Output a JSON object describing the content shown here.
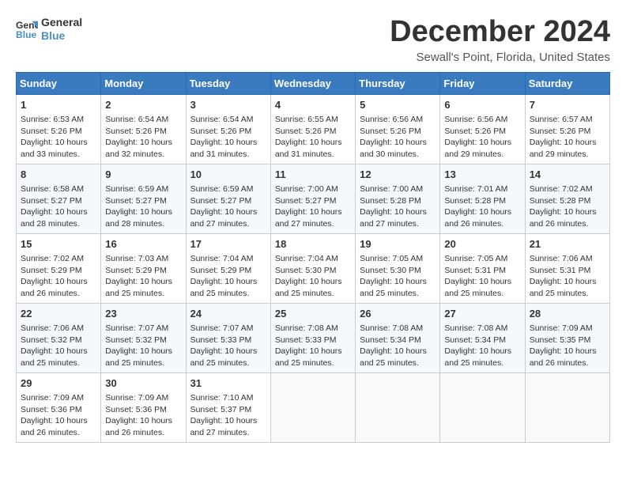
{
  "header": {
    "logo_line1": "General",
    "logo_line2": "Blue",
    "title": "December 2024",
    "subtitle": "Sewall's Point, Florida, United States"
  },
  "days_of_week": [
    "Sunday",
    "Monday",
    "Tuesday",
    "Wednesday",
    "Thursday",
    "Friday",
    "Saturday"
  ],
  "weeks": [
    [
      {
        "day": 1,
        "lines": [
          "Sunrise: 6:53 AM",
          "Sunset: 5:26 PM",
          "Daylight: 10 hours",
          "and 33 minutes."
        ]
      },
      {
        "day": 2,
        "lines": [
          "Sunrise: 6:54 AM",
          "Sunset: 5:26 PM",
          "Daylight: 10 hours",
          "and 32 minutes."
        ]
      },
      {
        "day": 3,
        "lines": [
          "Sunrise: 6:54 AM",
          "Sunset: 5:26 PM",
          "Daylight: 10 hours",
          "and 31 minutes."
        ]
      },
      {
        "day": 4,
        "lines": [
          "Sunrise: 6:55 AM",
          "Sunset: 5:26 PM",
          "Daylight: 10 hours",
          "and 31 minutes."
        ]
      },
      {
        "day": 5,
        "lines": [
          "Sunrise: 6:56 AM",
          "Sunset: 5:26 PM",
          "Daylight: 10 hours",
          "and 30 minutes."
        ]
      },
      {
        "day": 6,
        "lines": [
          "Sunrise: 6:56 AM",
          "Sunset: 5:26 PM",
          "Daylight: 10 hours",
          "and 29 minutes."
        ]
      },
      {
        "day": 7,
        "lines": [
          "Sunrise: 6:57 AM",
          "Sunset: 5:26 PM",
          "Daylight: 10 hours",
          "and 29 minutes."
        ]
      }
    ],
    [
      {
        "day": 8,
        "lines": [
          "Sunrise: 6:58 AM",
          "Sunset: 5:27 PM",
          "Daylight: 10 hours",
          "and 28 minutes."
        ]
      },
      {
        "day": 9,
        "lines": [
          "Sunrise: 6:59 AM",
          "Sunset: 5:27 PM",
          "Daylight: 10 hours",
          "and 28 minutes."
        ]
      },
      {
        "day": 10,
        "lines": [
          "Sunrise: 6:59 AM",
          "Sunset: 5:27 PM",
          "Daylight: 10 hours",
          "and 27 minutes."
        ]
      },
      {
        "day": 11,
        "lines": [
          "Sunrise: 7:00 AM",
          "Sunset: 5:27 PM",
          "Daylight: 10 hours",
          "and 27 minutes."
        ]
      },
      {
        "day": 12,
        "lines": [
          "Sunrise: 7:00 AM",
          "Sunset: 5:28 PM",
          "Daylight: 10 hours",
          "and 27 minutes."
        ]
      },
      {
        "day": 13,
        "lines": [
          "Sunrise: 7:01 AM",
          "Sunset: 5:28 PM",
          "Daylight: 10 hours",
          "and 26 minutes."
        ]
      },
      {
        "day": 14,
        "lines": [
          "Sunrise: 7:02 AM",
          "Sunset: 5:28 PM",
          "Daylight: 10 hours",
          "and 26 minutes."
        ]
      }
    ],
    [
      {
        "day": 15,
        "lines": [
          "Sunrise: 7:02 AM",
          "Sunset: 5:29 PM",
          "Daylight: 10 hours",
          "and 26 minutes."
        ]
      },
      {
        "day": 16,
        "lines": [
          "Sunrise: 7:03 AM",
          "Sunset: 5:29 PM",
          "Daylight: 10 hours",
          "and 25 minutes."
        ]
      },
      {
        "day": 17,
        "lines": [
          "Sunrise: 7:04 AM",
          "Sunset: 5:29 PM",
          "Daylight: 10 hours",
          "and 25 minutes."
        ]
      },
      {
        "day": 18,
        "lines": [
          "Sunrise: 7:04 AM",
          "Sunset: 5:30 PM",
          "Daylight: 10 hours",
          "and 25 minutes."
        ]
      },
      {
        "day": 19,
        "lines": [
          "Sunrise: 7:05 AM",
          "Sunset: 5:30 PM",
          "Daylight: 10 hours",
          "and 25 minutes."
        ]
      },
      {
        "day": 20,
        "lines": [
          "Sunrise: 7:05 AM",
          "Sunset: 5:31 PM",
          "Daylight: 10 hours",
          "and 25 minutes."
        ]
      },
      {
        "day": 21,
        "lines": [
          "Sunrise: 7:06 AM",
          "Sunset: 5:31 PM",
          "Daylight: 10 hours",
          "and 25 minutes."
        ]
      }
    ],
    [
      {
        "day": 22,
        "lines": [
          "Sunrise: 7:06 AM",
          "Sunset: 5:32 PM",
          "Daylight: 10 hours",
          "and 25 minutes."
        ]
      },
      {
        "day": 23,
        "lines": [
          "Sunrise: 7:07 AM",
          "Sunset: 5:32 PM",
          "Daylight: 10 hours",
          "and 25 minutes."
        ]
      },
      {
        "day": 24,
        "lines": [
          "Sunrise: 7:07 AM",
          "Sunset: 5:33 PM",
          "Daylight: 10 hours",
          "and 25 minutes."
        ]
      },
      {
        "day": 25,
        "lines": [
          "Sunrise: 7:08 AM",
          "Sunset: 5:33 PM",
          "Daylight: 10 hours",
          "and 25 minutes."
        ]
      },
      {
        "day": 26,
        "lines": [
          "Sunrise: 7:08 AM",
          "Sunset: 5:34 PM",
          "Daylight: 10 hours",
          "and 25 minutes."
        ]
      },
      {
        "day": 27,
        "lines": [
          "Sunrise: 7:08 AM",
          "Sunset: 5:34 PM",
          "Daylight: 10 hours",
          "and 25 minutes."
        ]
      },
      {
        "day": 28,
        "lines": [
          "Sunrise: 7:09 AM",
          "Sunset: 5:35 PM",
          "Daylight: 10 hours",
          "and 26 minutes."
        ]
      }
    ],
    [
      {
        "day": 29,
        "lines": [
          "Sunrise: 7:09 AM",
          "Sunset: 5:36 PM",
          "Daylight: 10 hours",
          "and 26 minutes."
        ]
      },
      {
        "day": 30,
        "lines": [
          "Sunrise: 7:09 AM",
          "Sunset: 5:36 PM",
          "Daylight: 10 hours",
          "and 26 minutes."
        ]
      },
      {
        "day": 31,
        "lines": [
          "Sunrise: 7:10 AM",
          "Sunset: 5:37 PM",
          "Daylight: 10 hours",
          "and 27 minutes."
        ]
      },
      null,
      null,
      null,
      null
    ]
  ]
}
